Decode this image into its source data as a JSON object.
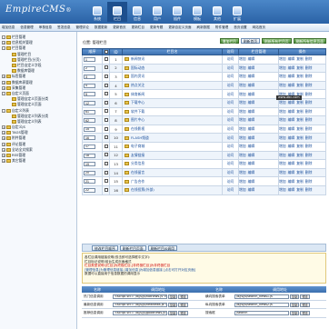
{
  "header": {
    "logo": "EmpireCMS",
    "logo_tm": "®",
    "nav": [
      "系统",
      "栏目",
      "信息",
      "用户",
      "插件",
      "模板",
      "其他",
      "扩展"
    ]
  },
  "quickbar": [
    "增加信息",
    "信息管理",
    "审核信息",
    "签发信息",
    "管理评论",
    "数据更新",
    "更新首页",
    "更新栏目",
    "更新专题",
    "更新自定义页面",
    "刷新数据",
    "附件管理",
    "首页设置",
    "网站首页"
  ],
  "sidebar": {
    "items": [
      {
        "label": "栏目管理",
        "toggle": "-",
        "level": 0
      },
      {
        "label": "信息相关管理",
        "toggle": "+",
        "level": 0
      },
      {
        "label": "栏目管理",
        "toggle": "-",
        "level": 0
      },
      {
        "label": "管理栏目",
        "toggle": "",
        "level": 1
      },
      {
        "label": "管理栏目(分页)",
        "toggle": "",
        "level": 1
      },
      {
        "label": "栏目自定义字段",
        "toggle": "",
        "level": 1
      },
      {
        "label": "数据库管理",
        "toggle": "",
        "level": 1
      },
      {
        "label": "标签管理",
        "toggle": "+",
        "level": 0
      },
      {
        "label": "数据库表管理",
        "toggle": "+",
        "level": 0
      },
      {
        "label": "采集管理",
        "toggle": "+",
        "level": 0
      },
      {
        "label": "自定义页面",
        "toggle": "-",
        "level": 0
      },
      {
        "label": "管理自定义页面分类",
        "toggle": "",
        "level": 1
      },
      {
        "label": "管理自定义页面",
        "toggle": "",
        "level": 1
      },
      {
        "label": "自定义列表",
        "toggle": "-",
        "level": 0
      },
      {
        "label": "管理自定义列表分类",
        "toggle": "",
        "level": 1
      },
      {
        "label": "管理自定义列表",
        "toggle": "",
        "level": 1
      },
      {
        "label": "自定义JS",
        "toggle": "+",
        "level": 0
      },
      {
        "label": "TAGS管理",
        "toggle": "+",
        "level": 0
      },
      {
        "label": "附件管理",
        "toggle": "+",
        "level": 0
      },
      {
        "label": "评论管理",
        "toggle": "+",
        "level": 0
      },
      {
        "label": "全站全文搜索",
        "toggle": "+",
        "level": 0
      },
      {
        "label": "RSS管理",
        "toggle": "+",
        "level": 0
      },
      {
        "label": "其它管理",
        "toggle": "+",
        "level": 0
      }
    ]
  },
  "main": {
    "position": "位置: 管理栏目",
    "buttons": [
      "增加栏目",
      "刷新首页",
      "刷新所有栏目页",
      "刷新所有信息页面"
    ],
    "table_headers": [
      "顺序",
      "",
      "ID",
      "栏目名",
      "访问",
      "栏目管理",
      "操作"
    ],
    "rows": [
      {
        "order": "1",
        "id": "1",
        "name": "新闻快讯",
        "ops": [
          "增加",
          "编辑",
          "复制",
          "删除"
        ],
        "access": "访问"
      },
      {
        "order": "2",
        "id": "2",
        "name": "国际动态",
        "ops": [
          "增加",
          "编辑",
          "复制",
          "删除"
        ],
        "access": "访问"
      },
      {
        "order": "3",
        "id": "3",
        "name": "国内资讯",
        "ops": [
          "增加",
          "编辑",
          "复制",
          "删除"
        ],
        "access": "访问"
      },
      {
        "order": "4",
        "id": "4",
        "name": "热点关注",
        "ops": [
          "增加",
          "编辑",
          "复制",
          "删除"
        ],
        "access": "访问"
      },
      {
        "order": "5",
        "id": "5",
        "name": "体育新闻",
        "ops": [
          "增加",
          "编辑",
          "复制",
          "删除"
        ],
        "access": "访问"
      },
      {
        "order": "12",
        "id": "6",
        "name": "下载中心",
        "ops": [
          "增加",
          "编辑",
          "复制",
          "删除"
        ],
        "access": "访问"
      },
      {
        "order": "61",
        "id": "7",
        "name": "软件下载",
        "ops": [
          "增加",
          "编辑",
          "复制",
          "删除"
        ],
        "access": "访问"
      },
      {
        "order": "62",
        "id": "8",
        "name": "图片中心",
        "ops": [
          "增加",
          "编辑",
          "复制",
          "删除"
        ],
        "access": "访问"
      },
      {
        "order": "15",
        "id": "9",
        "name": "在线影视",
        "ops": [
          "增加",
          "编辑",
          "复制",
          "删除"
        ],
        "access": "访问"
      },
      {
        "order": "16",
        "id": "10",
        "name": "FLASH频道",
        "ops": [
          "增加",
          "编辑",
          "复制",
          "删除"
        ],
        "access": "访问"
      },
      {
        "order": "17",
        "id": "11",
        "name": "电子商城",
        "ops": [
          "增加",
          "编辑",
          "复制",
          "删除"
        ],
        "access": "访问"
      },
      {
        "order": "18",
        "id": "12",
        "name": "友情链接",
        "ops": [
          "增加",
          "编辑",
          "复制",
          "删除"
        ],
        "access": "访问"
      },
      {
        "order": "19",
        "id": "13",
        "name": "分类信息",
        "ops": [
          "增加",
          "编辑",
          "复制",
          "删除"
        ],
        "access": "访问"
      },
      {
        "order": "20",
        "id": "14",
        "name": "在线留言",
        "ops": [
          "增加",
          "编辑",
          "复制",
          "删除"
        ],
        "access": "访问"
      },
      {
        "order": "21",
        "id": "15",
        "name": "广告合作",
        "ops": [
          "增加",
          "编辑",
          "复制",
          "删除"
        ],
        "access": "访问"
      },
      {
        "order": "22",
        "id": "16",
        "name": "在线投票(外部)",
        "ops": [
          "增加",
          "编辑",
          "复制",
          "删除"
        ],
        "access": "访问"
      }
    ],
    "tooltip": "www.abc.com",
    "bottom_buttons": [
      "修改栏目顺序",
      "刷新栏目页面",
      "刷新栏目JS调用"
    ],
    "notes": [
      {
        "text": "各栏目调用链接说明(双击即可选择框中文字):",
        "cls": ""
      },
      {
        "text": "栏目标记说明:前台生成页面格式",
        "cls": ""
      },
      {
        "text": "栏目类型说明:[栏目]为终极栏目,[非终极栏目]为非终极栏目",
        "cls": "red"
      },
      {
        "text": "[管理信息]为管理信息链接,[增加信息]为增加信息链接 [点击可打开对应页面]",
        "cls": "blue"
      },
      {
        "text": "数据可以直接用于信息数据的调用显示",
        "cls": ""
      }
    ],
    "js_headers": [
      "名称",
      "调用地址",
      "名称",
      "调用地址"
    ],
    "js_rows": [
      {
        "left_name": "热门信息调用",
        "left_val": "<script src=\"/d/js/js/hotnews.js\">",
        "right_name": "横向搜索表单",
        "right_val": "/d/js/js/search_news1.js"
      },
      {
        "left_name": "最新信息调用",
        "left_val": "<script src=\"/d/js/js/newnews.js\">",
        "right_name": "纵向搜索表单",
        "right_val": "/d/js/js/search_news2.js"
      },
      {
        "left_name": "推荐信息调用",
        "left_val": "<script src=\"/d/js/js/goodnews.js\">",
        "right_name": "搜索框",
        "right_val": "/search"
      }
    ],
    "js_buttons": [
      "复制",
      "预览"
    ]
  }
}
